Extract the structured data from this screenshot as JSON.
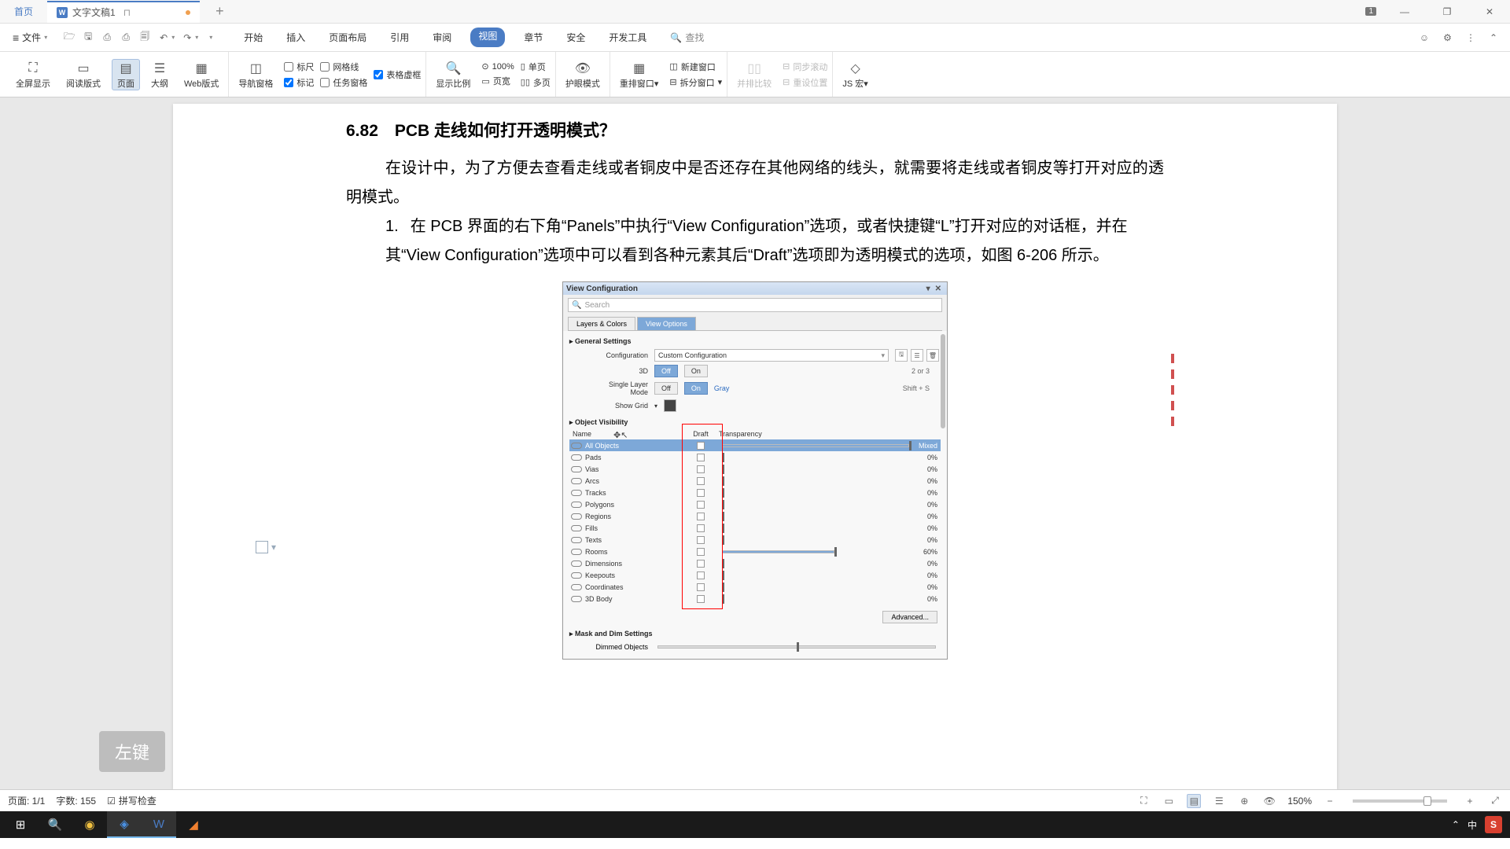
{
  "titlebar": {
    "home": "首页",
    "doc_icon": "W",
    "doc_title": "文字文稿1",
    "badge": "1"
  },
  "menubar": {
    "file": "文件",
    "tabs": [
      "开始",
      "插入",
      "页面布局",
      "引用",
      "审阅",
      "视图",
      "章节",
      "安全",
      "开发工具"
    ],
    "active_tab": "视图",
    "search": "查找"
  },
  "ribbon": {
    "fullscreen": "全屏显示",
    "reading": "阅读版式",
    "page_view": "页面",
    "outline": "大纲",
    "web": "Web版式",
    "nav_pane": "导航窗格",
    "ruler": "标尺",
    "gridlines": "网格线",
    "markup": "标记",
    "task_pane": "任务窗格",
    "table_grid": "表格虚框",
    "zoom_ratio": "显示比例",
    "pct100": "100%",
    "page_width": "页宽",
    "single_page": "单页",
    "multi_page": "多页",
    "eye_mode": "护眼模式",
    "rearrange": "重排窗口",
    "new_window": "新建窗口",
    "split_window": "拆分窗口",
    "side_by_side": "并排比较",
    "sync_scroll": "同步滚动",
    "reset_pos": "重设位置",
    "js_macro": "JS 宏"
  },
  "document": {
    "section_no": "6.82",
    "section_title": "PCB 走线如何打开透明模式？",
    "para1": "在设计中，为了方便去查看走线或者铜皮中是否还存在其他网络的线头，就需要将走线或者铜皮等打开对应的透明模式。",
    "step_num": "1.",
    "step_text_a": "在 PCB 界面的右下角“Panels”中执行“View Configuration”选项，或者快捷键“L”打开对应的对话框，并在其“View Configuration”选项中可以看到各种元素其后“Draft”选项即为透明模式的选项，如图 6-206 所示。"
  },
  "embedded": {
    "title": "View Configuration",
    "search_ph": "Search",
    "tab1": "Layers & Colors",
    "tab2": "View Options",
    "sect_general": "General Settings",
    "row_config": "Configuration",
    "config_value": "Custom Configuration",
    "row_3d": "3D",
    "off": "Off",
    "on": "On",
    "gray": "Gray",
    "shortcut_3d": "2 or 3",
    "row_slm": "Single Layer Mode",
    "shortcut_slm": "Shift + S",
    "row_grid": "Show Grid",
    "sect_objvis": "Object Visibility",
    "col_name": "Name",
    "col_draft": "Draft",
    "col_trans": "Transparency",
    "rows": [
      {
        "name": "All Objects",
        "pct": "Mixed",
        "sel": true,
        "fill": 100
      },
      {
        "name": "Pads",
        "pct": "0%",
        "fill": 0
      },
      {
        "name": "Vias",
        "pct": "0%",
        "fill": 0
      },
      {
        "name": "Arcs",
        "pct": "0%",
        "fill": 0
      },
      {
        "name": "Tracks",
        "pct": "0%",
        "fill": 0
      },
      {
        "name": "Polygons",
        "pct": "0%",
        "fill": 0
      },
      {
        "name": "Regions",
        "pct": "0%",
        "fill": 0
      },
      {
        "name": "Fills",
        "pct": "0%",
        "fill": 0
      },
      {
        "name": "Texts",
        "pct": "0%",
        "fill": 0
      },
      {
        "name": "Rooms",
        "pct": "60%",
        "fill": 60
      },
      {
        "name": "Dimensions",
        "pct": "0%",
        "fill": 0
      },
      {
        "name": "Keepouts",
        "pct": "0%",
        "fill": 0
      },
      {
        "name": "Coordinates",
        "pct": "0%",
        "fill": 0
      },
      {
        "name": "3D Body",
        "pct": "0%",
        "fill": 0
      }
    ],
    "advanced": "Advanced...",
    "sect_mask": "Mask and Dim Settings",
    "row_dimmed": "Dimmed Objects"
  },
  "overlay": {
    "left_key": "左键"
  },
  "statusbar": {
    "page": "页面: 1/1",
    "words": "字数: 155",
    "spell": "拼写检查",
    "zoom": "150%"
  },
  "taskbar": {
    "ime_lang": "中"
  }
}
